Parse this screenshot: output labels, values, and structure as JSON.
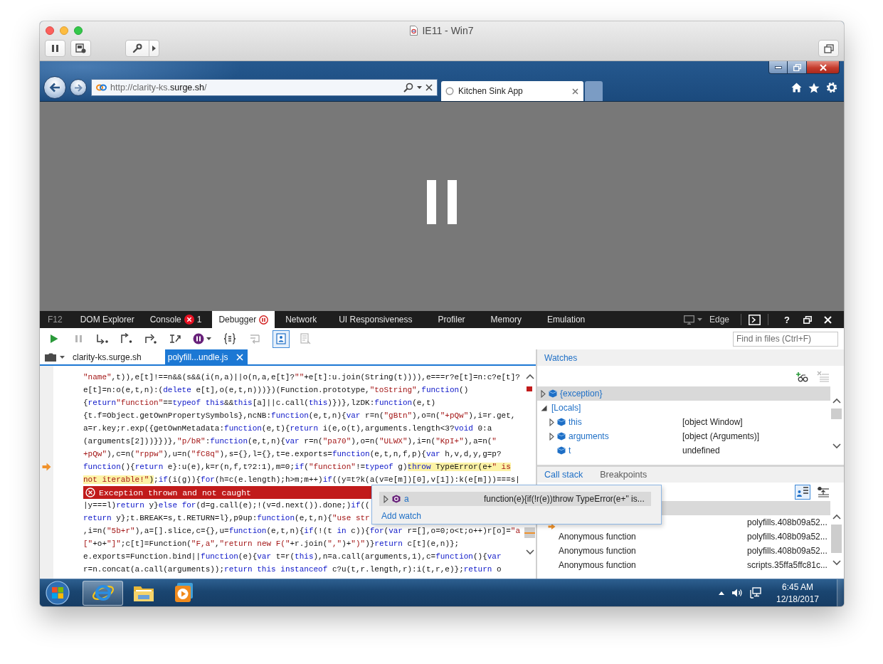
{
  "mac_window": {
    "title": "IE11 - Win7"
  },
  "browser": {
    "address": "http://clarity-ks.**surge.sh**/",
    "tabs": [
      {
        "title": "Kitchen Sink App",
        "selected": true
      }
    ]
  },
  "devtools": {
    "title": "F12",
    "tabs": [
      {
        "label": "DOM Explorer",
        "selected": false
      },
      {
        "label": "Console",
        "selected": false,
        "badge": {
          "kind": "error",
          "count": "1"
        }
      },
      {
        "label": "Debugger",
        "selected": true,
        "badge": {
          "kind": "paused"
        }
      },
      {
        "label": "Network",
        "selected": false
      },
      {
        "label": "UI Responsiveness",
        "selected": false
      },
      {
        "label": "Profiler",
        "selected": false
      },
      {
        "label": "Memory",
        "selected": false
      },
      {
        "label": "Emulation",
        "selected": false
      }
    ],
    "target": "Edge",
    "help": "?",
    "toolbar": [
      {
        "kind": "continue",
        "disabled": false,
        "selected": false
      },
      {
        "kind": "break",
        "disabled": true,
        "selected": false
      },
      {
        "kind": "step_into",
        "disabled": false,
        "selected": false
      },
      {
        "kind": "step_over",
        "disabled": false,
        "selected": false
      },
      {
        "kind": "step_out",
        "disabled": false,
        "selected": false
      },
      {
        "kind": "new_worker",
        "disabled": false,
        "selected": false
      },
      {
        "kind": "exceptions",
        "disabled": false,
        "selected": false
      },
      {
        "kind": "pretty_print",
        "disabled": false,
        "selected": false
      },
      {
        "kind": "word_wrap",
        "disabled": true,
        "selected": false
      },
      {
        "kind": "just_my_code",
        "disabled": false,
        "selected": true
      },
      {
        "kind": "source_maps",
        "disabled": true,
        "selected": false
      }
    ],
    "search": {
      "placeholder": "Find in files (Ctrl+F)"
    },
    "file_tabs": [
      {
        "label": "clarity-ks.surge.sh",
        "selected": false
      },
      {
        "label": "polyfill...undle.js",
        "selected": true
      }
    ],
    "code": {
      "lines": [
        {
          "kind": "code",
          "current": false,
          "tokens": [
            {
              "kind": "string",
              "text": "\"name\""
            },
            {
              "kind": "plain",
              "text": ",t)),e[t]!==n&&(s&&(i(n,a)||o(n,a,e[t]?"
            },
            {
              "kind": "string",
              "text": "\"\""
            },
            {
              "kind": "plain",
              "text": "+e[t]:u.join(String(t)))),e===r?e[t]=n:c?e[t]?"
            }
          ]
        },
        {
          "kind": "code",
          "current": false,
          "tokens": [
            {
              "kind": "plain",
              "text": "e[t]=n:o(e,t,n):("
            },
            {
              "kind": "keyword",
              "text": "delete"
            },
            {
              "kind": "plain",
              "text": " e[t],o(e,t,n)))})(Function.prototype,"
            },
            {
              "kind": "string",
              "text": "\"toString\""
            },
            {
              "kind": "plain",
              "text": ","
            },
            {
              "kind": "keyword",
              "text": "function"
            },
            {
              "kind": "plain",
              "text": "()"
            }
          ]
        },
        {
          "kind": "code",
          "current": false,
          "tokens": [
            {
              "kind": "plain",
              "text": "{"
            },
            {
              "kind": "keyword",
              "text": "return"
            },
            {
              "kind": "string",
              "text": "\"function\""
            },
            {
              "kind": "plain",
              "text": "=="
            },
            {
              "kind": "keyword",
              "text": "typeof "
            },
            {
              "kind": "keyword",
              "text": "this"
            },
            {
              "kind": "plain",
              "text": "&&"
            },
            {
              "kind": "keyword",
              "text": "this"
            },
            {
              "kind": "plain",
              "text": "[a]||c.call("
            },
            {
              "kind": "keyword",
              "text": "this"
            },
            {
              "kind": "plain",
              "text": ")})},lzDK:"
            },
            {
              "kind": "keyword",
              "text": "function"
            },
            {
              "kind": "plain",
              "text": "(e,t)"
            }
          ]
        },
        {
          "kind": "code",
          "current": false,
          "tokens": [
            {
              "kind": "plain",
              "text": "{t.f=Object.getOwnPropertySymbols},ncNB:"
            },
            {
              "kind": "keyword",
              "text": "function"
            },
            {
              "kind": "plain",
              "text": "(e,t,n){"
            },
            {
              "kind": "keyword",
              "text": "var"
            },
            {
              "kind": "plain",
              "text": " r=n("
            },
            {
              "kind": "string",
              "text": "\"gBtn\""
            },
            {
              "kind": "plain",
              "text": "),o=n("
            },
            {
              "kind": "string",
              "text": "\"+pQw\""
            },
            {
              "kind": "plain",
              "text": "),i=r.get,"
            }
          ]
        },
        {
          "kind": "code",
          "current": false,
          "tokens": [
            {
              "kind": "plain",
              "text": "a=r.key;r.exp({getOwnMetadata:"
            },
            {
              "kind": "keyword",
              "text": "function"
            },
            {
              "kind": "plain",
              "text": "(e,t){"
            },
            {
              "kind": "keyword",
              "text": "return"
            },
            {
              "kind": "plain",
              "text": " i(e,o(t),arguments.length<3?"
            },
            {
              "kind": "keyword",
              "text": "void"
            },
            {
              "kind": "plain",
              "text": " 0:a"
            }
          ]
        },
        {
          "kind": "code",
          "current": false,
          "tokens": [
            {
              "kind": "plain",
              "text": "(arguments[2]))}})},"
            },
            {
              "kind": "string",
              "text": "\"p/bR\""
            },
            {
              "kind": "plain",
              "text": ":"
            },
            {
              "kind": "keyword",
              "text": "function"
            },
            {
              "kind": "plain",
              "text": "(e,t,n){"
            },
            {
              "kind": "keyword",
              "text": "var"
            },
            {
              "kind": "plain",
              "text": " r=n("
            },
            {
              "kind": "string",
              "text": "\"pa70\""
            },
            {
              "kind": "plain",
              "text": "),o=n("
            },
            {
              "kind": "string",
              "text": "\"ULWX\""
            },
            {
              "kind": "plain",
              "text": "),i=n("
            },
            {
              "kind": "string",
              "text": "\"KpI+\""
            },
            {
              "kind": "plain",
              "text": "),a=n("
            },
            {
              "kind": "string",
              "text": "\""
            }
          ]
        },
        {
          "kind": "code",
          "current": false,
          "tokens": [
            {
              "kind": "string",
              "text": "+pQw\""
            },
            {
              "kind": "plain",
              "text": "),c=n("
            },
            {
              "kind": "string",
              "text": "\"rppw\""
            },
            {
              "kind": "plain",
              "text": "),u=n("
            },
            {
              "kind": "string",
              "text": "\"fC8q\""
            },
            {
              "kind": "plain",
              "text": "),s={},l={},t=e.exports="
            },
            {
              "kind": "keyword",
              "text": "function"
            },
            {
              "kind": "plain",
              "text": "(e,t,n,f,p){"
            },
            {
              "kind": "keyword",
              "text": "var"
            },
            {
              "kind": "plain",
              "text": " h,v,d,y,g=p?"
            }
          ]
        },
        {
          "kind": "code",
          "current": true,
          "tokens": [
            {
              "kind": "keyword",
              "text": "function"
            },
            {
              "kind": "plain",
              "text": "(){"
            },
            {
              "kind": "keyword",
              "text": "return"
            },
            {
              "kind": "plain",
              "text": " e}:u(e),k=r(n,f,t?2:1),m=0;"
            },
            {
              "kind": "keyword",
              "text": "if"
            },
            {
              "kind": "plain",
              "text": "("
            },
            {
              "kind": "string",
              "text": "\"function\""
            },
            {
              "kind": "plain",
              "text": "!="
            },
            {
              "kind": "keyword",
              "text": "typeof"
            },
            {
              "kind": "plain",
              "text": " g)"
            },
            {
              "kind": "keyword",
              "text": "throw",
              "highlighted": true
            },
            {
              "kind": "plain",
              "text": " TypeError(e+",
              "highlighted": true
            },
            {
              "kind": "string",
              "text": "\" is",
              "highlighted": true
            }
          ]
        },
        {
          "kind": "code",
          "current": false,
          "tokens": [
            {
              "kind": "string",
              "text": "not iterable!\"",
              "highlighted": true
            },
            {
              "kind": "plain",
              "text": ")",
              "highlighted": true
            },
            {
              "kind": "plain",
              "text": ";"
            },
            {
              "kind": "keyword",
              "text": "if"
            },
            {
              "kind": "plain",
              "text": "(i(g)){"
            },
            {
              "kind": "keyword",
              "text": "for"
            },
            {
              "kind": "plain",
              "text": "(h=c(e.length);h>m;m++)"
            },
            {
              "kind": "keyword",
              "text": "if"
            },
            {
              "kind": "plain",
              "text": "((y=t?k(a(v=e[m])[0],v[1]):k(e[m]))===s|"
            }
          ]
        },
        {
          "kind": "exception",
          "text": "Exception thrown and not caught"
        },
        {
          "kind": "code",
          "current": false,
          "tokens": [
            {
              "kind": "plain",
              "text": "|y===l)"
            },
            {
              "kind": "keyword",
              "text": "return"
            },
            {
              "kind": "plain",
              "text": " y}"
            },
            {
              "kind": "keyword",
              "text": "else "
            },
            {
              "kind": "keyword",
              "text": "for"
            },
            {
              "kind": "plain",
              "text": "(d=g.call(e);!(v=d.next()).done;)"
            },
            {
              "kind": "keyword",
              "text": "if"
            },
            {
              "kind": "plain",
              "text": "(("
            }
          ]
        },
        {
          "kind": "code",
          "current": false,
          "tokens": [
            {
              "kind": "keyword",
              "text": "return"
            },
            {
              "kind": "plain",
              "text": " y};t.BREAK=s,t.RETURN=l},p9up:"
            },
            {
              "kind": "keyword",
              "text": "function"
            },
            {
              "kind": "plain",
              "text": "(e,t,n){"
            },
            {
              "kind": "string",
              "text": "\"use str"
            }
          ]
        },
        {
          "kind": "code",
          "current": false,
          "tokens": [
            {
              "kind": "plain",
              "text": ",i=n("
            },
            {
              "kind": "string",
              "text": "\"5b+r\""
            },
            {
              "kind": "plain",
              "text": "),a=[].slice,c={},u="
            },
            {
              "kind": "keyword",
              "text": "function"
            },
            {
              "kind": "plain",
              "text": "(e,t,n){"
            },
            {
              "kind": "keyword",
              "text": "if"
            },
            {
              "kind": "plain",
              "text": "(!(t "
            },
            {
              "kind": "keyword",
              "text": "in"
            },
            {
              "kind": "plain",
              "text": " c)){"
            },
            {
              "kind": "keyword",
              "text": "for"
            },
            {
              "kind": "plain",
              "text": "("
            },
            {
              "kind": "keyword",
              "text": "var"
            },
            {
              "kind": "plain",
              "text": " r=[],o=0;o<t;o++)r[o]="
            },
            {
              "kind": "string",
              "text": "\"a"
            }
          ]
        },
        {
          "kind": "code",
          "current": false,
          "tokens": [
            {
              "kind": "string",
              "text": "[\""
            },
            {
              "kind": "plain",
              "text": "+o+"
            },
            {
              "kind": "string",
              "text": "\"]\""
            },
            {
              "kind": "plain",
              "text": ";c[t]=Function("
            },
            {
              "kind": "string",
              "text": "\"F,a\""
            },
            {
              "kind": "plain",
              "text": ","
            },
            {
              "kind": "string",
              "text": "\"return new F(\""
            },
            {
              "kind": "plain",
              "text": "+r.join("
            },
            {
              "kind": "string",
              "text": "\",\""
            },
            {
              "kind": "plain",
              "text": ")+"
            },
            {
              "kind": "string",
              "text": "\")\""
            },
            {
              "kind": "plain",
              "text": ")}"
            },
            {
              "kind": "keyword",
              "text": "return"
            },
            {
              "kind": "plain",
              "text": " c[t](e,n)};"
            }
          ]
        },
        {
          "kind": "code",
          "current": false,
          "tokens": [
            {
              "kind": "plain",
              "text": "e.exports=Function.bind||"
            },
            {
              "kind": "keyword",
              "text": "function"
            },
            {
              "kind": "plain",
              "text": "(e){"
            },
            {
              "kind": "keyword",
              "text": "var"
            },
            {
              "kind": "plain",
              "text": " t=r("
            },
            {
              "kind": "keyword",
              "text": "this"
            },
            {
              "kind": "plain",
              "text": "),n=a.call(arguments,1),c="
            },
            {
              "kind": "keyword",
              "text": "function"
            },
            {
              "kind": "plain",
              "text": "(){"
            },
            {
              "kind": "keyword",
              "text": "var"
            }
          ]
        },
        {
          "kind": "code",
          "current": false,
          "tokens": [
            {
              "kind": "plain",
              "text": "r=n.concat(a.call(arguments));"
            },
            {
              "kind": "keyword",
              "text": "return "
            },
            {
              "kind": "keyword",
              "text": "this "
            },
            {
              "kind": "keyword",
              "text": "instanceof"
            },
            {
              "kind": "plain",
              "text": " c?u(t,r.length,r):i(t,r,e)};"
            },
            {
              "kind": "keyword",
              "text": "return"
            },
            {
              "kind": "plain",
              "text": " o"
            }
          ]
        }
      ]
    },
    "datatip": {
      "items": [
        {
          "name": "a",
          "value": "function(e){if(!r(e))throw TypeError(e+\" is...",
          "kind": "function",
          "expanded": false,
          "selected": true
        }
      ],
      "action": "Add watch"
    },
    "watches": {
      "title": "Watches",
      "toolbar": [
        {
          "kind": "add",
          "disabled": false
        },
        {
          "kind": "delete_all",
          "disabled": true
        }
      ],
      "items": [
        {
          "name": "{exception}",
          "kind": "object",
          "expandable": true,
          "expanded": false,
          "selected": true
        },
        {
          "name": "[Locals]",
          "kind": "scope",
          "expandable": true,
          "expanded": true,
          "selected": false,
          "children": [
            {
              "name": "this",
              "value": "[object Window]",
              "kind": "object",
              "expandable": true,
              "expanded": false,
              "selected": false
            },
            {
              "name": "arguments",
              "value": "[object (Arguments)]",
              "kind": "object",
              "expandable": true,
              "expanded": false,
              "selected": false
            },
            {
              "name": "t",
              "value": "undefined",
              "kind": "object",
              "expandable": false,
              "expanded": false,
              "selected": false
            }
          ]
        }
      ]
    },
    "call_stack": {
      "tabs": [
        {
          "label": "Call stack",
          "selected": true
        },
        {
          "label": "Breakpoints",
          "selected": false
        }
      ],
      "toolbar": [
        {
          "kind": "show_frames",
          "selected": true
        },
        {
          "kind": "async",
          "selected": false
        }
      ],
      "frames": [
        {
          "selected": true,
          "current": false
        },
        {
          "location": "polyfills.408b09a52...",
          "selected": false,
          "current": true
        },
        {
          "name": "Anonymous function",
          "location": "polyfills.408b09a52...",
          "selected": false,
          "current": false
        },
        {
          "name": "Anonymous function",
          "location": "polyfills.408b09a52...",
          "selected": false,
          "current": false
        },
        {
          "name": "Anonymous function",
          "location": "scripts.35ffa5ffc81c...",
          "selected": false,
          "current": false
        }
      ]
    }
  },
  "taskbar": {
    "apps": [
      {
        "kind": "browser",
        "active": true
      },
      {
        "kind": "folder",
        "active": false
      },
      {
        "kind": "player",
        "active": false
      }
    ],
    "time": "6:45 AM",
    "date": "12/18/2017"
  }
}
